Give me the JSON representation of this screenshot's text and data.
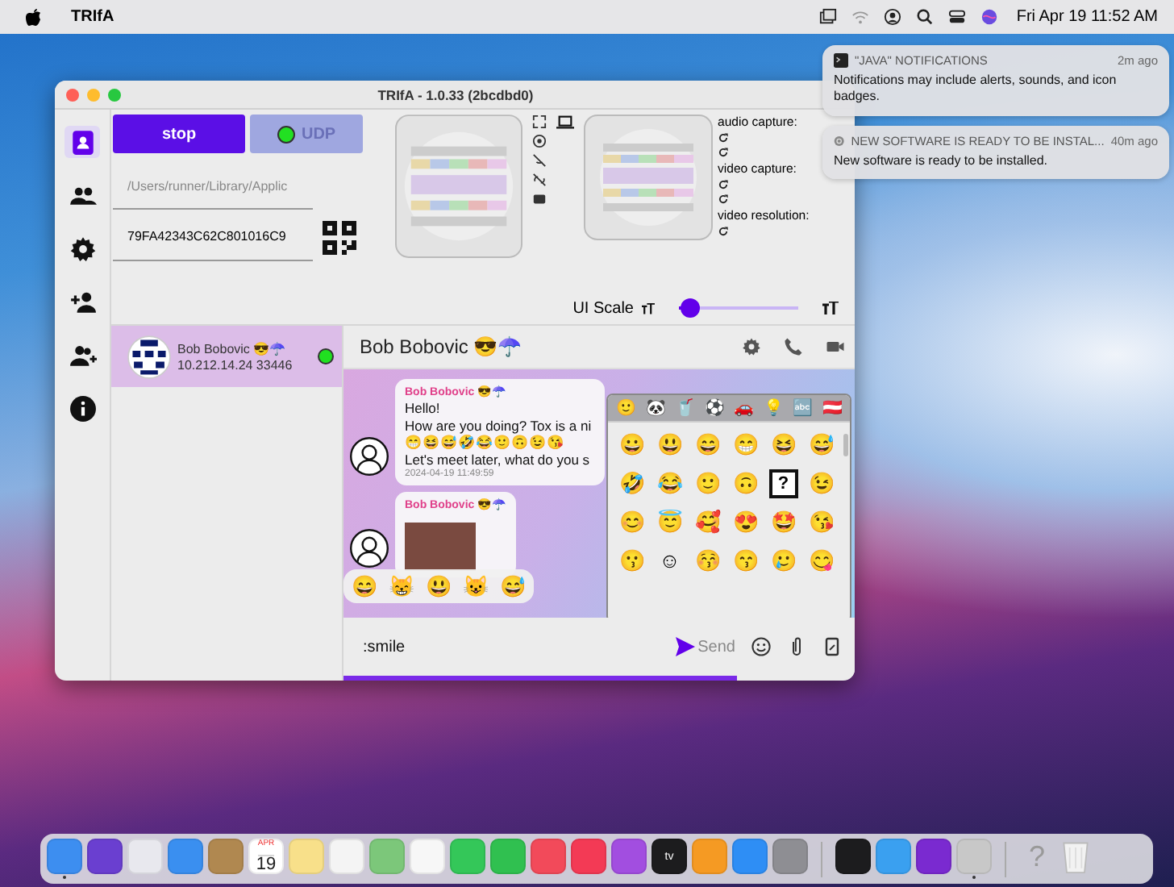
{
  "menubar": {
    "app": "TRIfA",
    "clock": "Fri Apr 19  11:52 AM"
  },
  "notifications": [
    {
      "app": "\"JAVA\" NOTIFICATIONS",
      "time": "2m ago",
      "body": "Notifications may include alerts, sounds, and icon badges."
    },
    {
      "app": "NEW SOFTWARE IS READY TO BE INSTAL...",
      "time": "40m ago",
      "body": "New software is ready to be installed."
    }
  ],
  "window": {
    "title": "TRIfA - 1.0.33 (2bcdbd0)"
  },
  "nav": [
    {
      "selected": true
    },
    {
      "selected": false
    },
    {
      "selected": false
    },
    {
      "selected": false
    },
    {
      "selected": false
    },
    {
      "selected": false
    }
  ],
  "controls": {
    "stop": "stop",
    "udp": "UDP",
    "udp_online": true,
    "path": "/Users/runner/Library/Applic",
    "tox_id": "79FA42343C62C801016C9"
  },
  "av": {
    "audio_label": "audio capture:",
    "video_label": "video capture:",
    "resolution_label": "video resolution:"
  },
  "ui_scale": {
    "label": "UI Scale",
    "level": 0.1
  },
  "contacts": [
    {
      "name": "Bob Bobovic 😎☂️",
      "address": "10.212.14.24 33446",
      "online": true,
      "selected": true
    }
  ],
  "chat": {
    "title": "Bob Bobovic 😎☂️",
    "messages": [
      {
        "kind": "text",
        "sender": "Bob Bobovic 😎☂️",
        "lines": [
          "Hello!",
          "How are you doing? Tox is a ni",
          "😁😆😅🤣😂🙂🙃😉😘",
          "Let's meet later, what do you s"
        ],
        "time": "2024-04-19 11:49:59"
      },
      {
        "kind": "image",
        "sender": "Bob Bobovic 😎☂️"
      }
    ],
    "suggestions": [
      "😄",
      "😸",
      "😃",
      "😺",
      "😅"
    ],
    "input": {
      "value": ":smile"
    },
    "send": "Send"
  },
  "emoji_picker": {
    "categories": [
      "🙂",
      "🐼",
      "🥤",
      "⚽",
      "🚗",
      "💡",
      "🔤",
      "🇦🇹"
    ],
    "emojis": [
      {
        "kind": "emoji",
        "glyph": "😀"
      },
      {
        "kind": "emoji",
        "glyph": "😃"
      },
      {
        "kind": "emoji",
        "glyph": "😄"
      },
      {
        "kind": "emoji",
        "glyph": "😁"
      },
      {
        "kind": "emoji",
        "glyph": "😆"
      },
      {
        "kind": "emoji",
        "glyph": "😅"
      },
      {
        "kind": "emoji",
        "glyph": "🤣"
      },
      {
        "kind": "emoji",
        "glyph": "😂"
      },
      {
        "kind": "emoji",
        "glyph": "🙂"
      },
      {
        "kind": "emoji",
        "glyph": "🙃"
      },
      {
        "kind": "missing",
        "glyph": "?"
      },
      {
        "kind": "emoji",
        "glyph": "😉"
      },
      {
        "kind": "emoji",
        "glyph": "😊"
      },
      {
        "kind": "emoji",
        "glyph": "😇"
      },
      {
        "kind": "emoji",
        "glyph": "🥰"
      },
      {
        "kind": "emoji",
        "glyph": "😍"
      },
      {
        "kind": "emoji",
        "glyph": "🤩"
      },
      {
        "kind": "emoji",
        "glyph": "😘"
      },
      {
        "kind": "emoji",
        "glyph": "😗"
      },
      {
        "kind": "emoji",
        "glyph": "☺"
      },
      {
        "kind": "emoji",
        "glyph": "😚"
      },
      {
        "kind": "emoji",
        "glyph": "😙"
      },
      {
        "kind": "emoji",
        "glyph": "🥲"
      },
      {
        "kind": "emoji",
        "glyph": "😋"
      }
    ]
  },
  "dock": {
    "apps": [
      {
        "color": "#3d8ef0",
        "running": true
      },
      {
        "color": "#6a3fd0",
        "running": false
      },
      {
        "color": "#e8e8ee",
        "running": false
      },
      {
        "color": "#3a8ff0",
        "running": false
      },
      {
        "color": "#b08850",
        "running": false
      },
      {
        "color": "#ffffff",
        "running": false,
        "label": "APR",
        "sublabel": "19"
      },
      {
        "color": "#f8e08a",
        "running": false
      },
      {
        "color": "#f4f4f4",
        "running": false
      },
      {
        "color": "#7cc77a",
        "running": false
      },
      {
        "color": "#f7f7f7",
        "running": false
      },
      {
        "color": "#34c759",
        "running": false
      },
      {
        "color": "#30c050",
        "running": false
      },
      {
        "color": "#f24a5a",
        "running": false
      },
      {
        "color": "#f33a55",
        "running": false
      },
      {
        "color": "#a24ee0",
        "running": false
      },
      {
        "color": "#1c1c1e",
        "running": false,
        "label": "tv"
      },
      {
        "color": "#f59a23",
        "running": false
      },
      {
        "color": "#2e8ef5",
        "running": false
      },
      {
        "color": "#8e8e93",
        "running": false
      }
    ],
    "recent": [
      {
        "color": "#1c1c1e",
        "running": false
      },
      {
        "color": "#3aa0f0",
        "running": false
      },
      {
        "color": "#7a2ad0",
        "running": false
      },
      {
        "color": "#c8c8c8",
        "running": true
      }
    ],
    "help": "?"
  }
}
